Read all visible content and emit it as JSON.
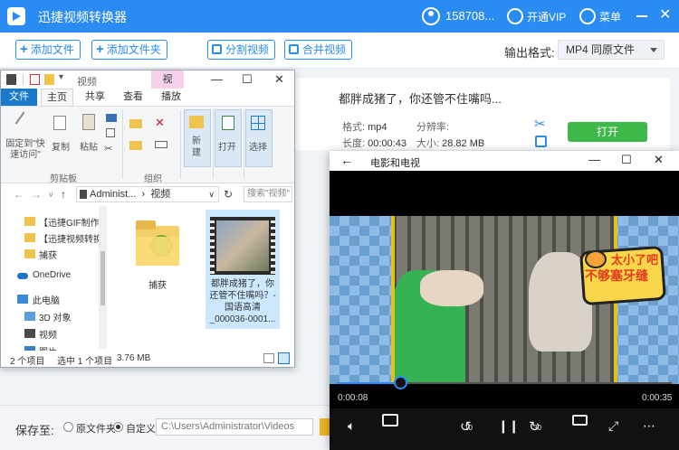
{
  "app": {
    "title": "迅捷视频转换器",
    "user_id": "158708...",
    "vip_label": "开通VIP",
    "menu_label": "菜单",
    "accent_color": "#2a8bf2"
  },
  "toolbar": {
    "add_file": "添加文件",
    "add_folder": "添加文件夹",
    "split_video": "分割视频",
    "merge_video": "合并视频",
    "output_format_label": "输出格式:",
    "output_format_value": "MP4  同原文件"
  },
  "file_item": {
    "title": "都胖成猪了，你还管不住嘴吗...",
    "format_label": "格式:",
    "format_value": "mp4",
    "resolution_label": "分辨率:",
    "resolution_value": "",
    "duration_label": "长度:",
    "duration_value": "00:00:43",
    "size_label": "大小:",
    "size_value": "28.82 MB",
    "open_button": "打开"
  },
  "bottom": {
    "save_to_label": "保存至:",
    "option_original": "原文件夹",
    "option_custom": "自定义",
    "path_value": "C:\\Users\\Administrator\\Videos"
  },
  "explorer": {
    "title": "视频",
    "context_tab": "视",
    "tabs": [
      "文件",
      "主页",
      "共享",
      "查看",
      "播放"
    ],
    "ribbon": {
      "pin": "固定到\"快\n速访问\"",
      "copy": "复制",
      "paste": "粘贴",
      "clipboard_group": "剪贴板",
      "organize_group": "组织",
      "new": "新\n建",
      "open": "打开",
      "select": "选择"
    },
    "address": "Administ... › 视频",
    "address_root": "Administ...",
    "address_leaf": "视频",
    "search_placeholder": "搜索\"视频\"",
    "nav_items": [
      "【迅捷GIF制作】",
      "【迅捷视频转换",
      "捕获",
      "OneDrive",
      "此电脑",
      "3D 对象",
      "视频",
      "图片"
    ],
    "items": [
      {
        "name": "捕获"
      },
      {
        "name": "都胖成猪了，你还管不住嘴吗？- 国语高清_000036-0001..."
      }
    ],
    "status_count": "2 个项目",
    "status_selected": "选中 1 个项目",
    "status_size": "3.76 MB"
  },
  "player": {
    "title": "电影和电视",
    "sticker_line1": "太小了吧",
    "sticker_line2": "不够塞牙缝",
    "time_current": "0:00:08",
    "time_total": "0:00:35",
    "progress": 0.19,
    "skip_back": "10",
    "skip_forward": "30"
  }
}
